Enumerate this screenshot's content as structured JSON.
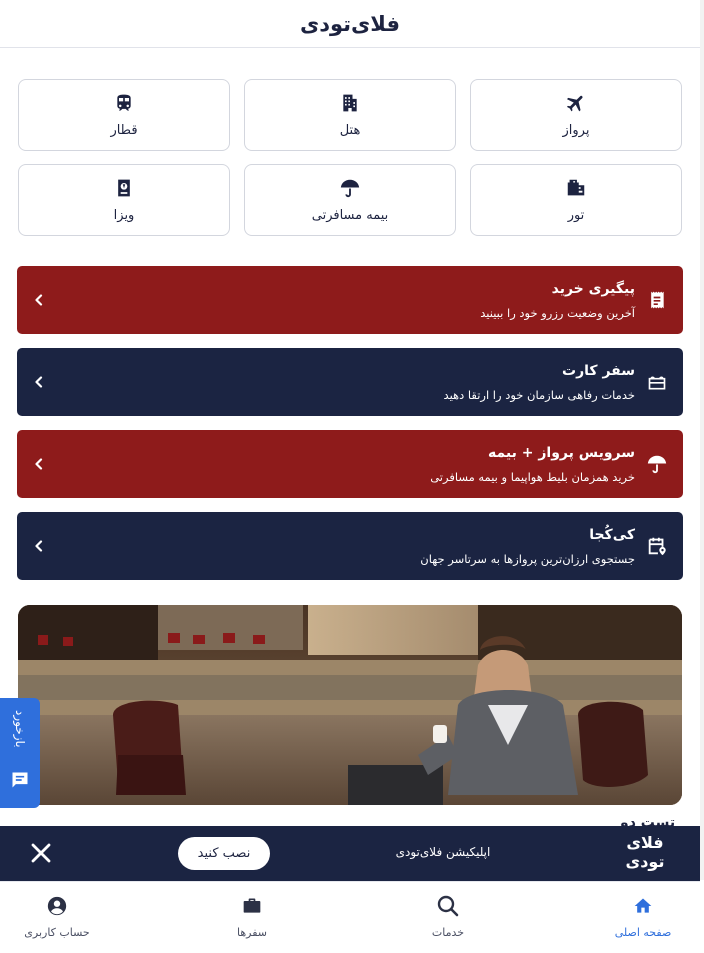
{
  "header": {
    "logo_text": "فلای‌تودی"
  },
  "services": [
    {
      "label": "پرواز",
      "icon": "airplane-icon"
    },
    {
      "label": "هتل",
      "icon": "hotel-building-icon"
    },
    {
      "label": "قطار",
      "icon": "train-icon"
    },
    {
      "label": "تور",
      "icon": "luggage-icon"
    },
    {
      "label": "بیمه مسافرتی",
      "icon": "umbrella-icon"
    },
    {
      "label": "ویزا",
      "icon": "passport-icon"
    }
  ],
  "banners": [
    {
      "title": "پیگیری خرید",
      "subtitle": "آخرین وضعیت رزرو خود را ببینید",
      "icon": "receipt-icon",
      "color": "#8e1b1b"
    },
    {
      "title": "سفر کارت",
      "subtitle": "خدمات رفاهی سازمان خود را ارتقا دهید",
      "icon": "gift-card-icon",
      "color": "#1b2442"
    },
    {
      "title": "سرویس پرواز + بیمه",
      "subtitle": "خرید همزمان بلیط هواپیما و بیمه مسافرتی",
      "icon": "umbrella-icon",
      "color": "#8e1b1b"
    },
    {
      "title": "کی‌کُجا",
      "subtitle": "جستجوی ارزان‌ترین پروازها به سرتاسر جهان",
      "icon": "calendar-pin-icon",
      "color": "#1b2442"
    }
  ],
  "section_peek": {
    "title": "تست دو"
  },
  "feedback": {
    "label": "بازخورد"
  },
  "app_banner": {
    "logo_line1": "فلای",
    "logo_line2": "تودی",
    "text": "اپلیکیشن فلای‌تودی",
    "install_label": "نصب کنید"
  },
  "bottom_nav": [
    {
      "label": "صفحه اصلی",
      "icon": "home-icon",
      "active": true
    },
    {
      "label": "خدمات",
      "icon": "search-icon",
      "active": false
    },
    {
      "label": "سفرها",
      "icon": "briefcase-icon",
      "active": false
    },
    {
      "label": "حساب کاربری",
      "icon": "user-circle-icon",
      "active": false
    }
  ],
  "colors": {
    "navy": "#1b2442",
    "red": "#8e1b1b",
    "accent_blue": "#2f6fdc"
  }
}
